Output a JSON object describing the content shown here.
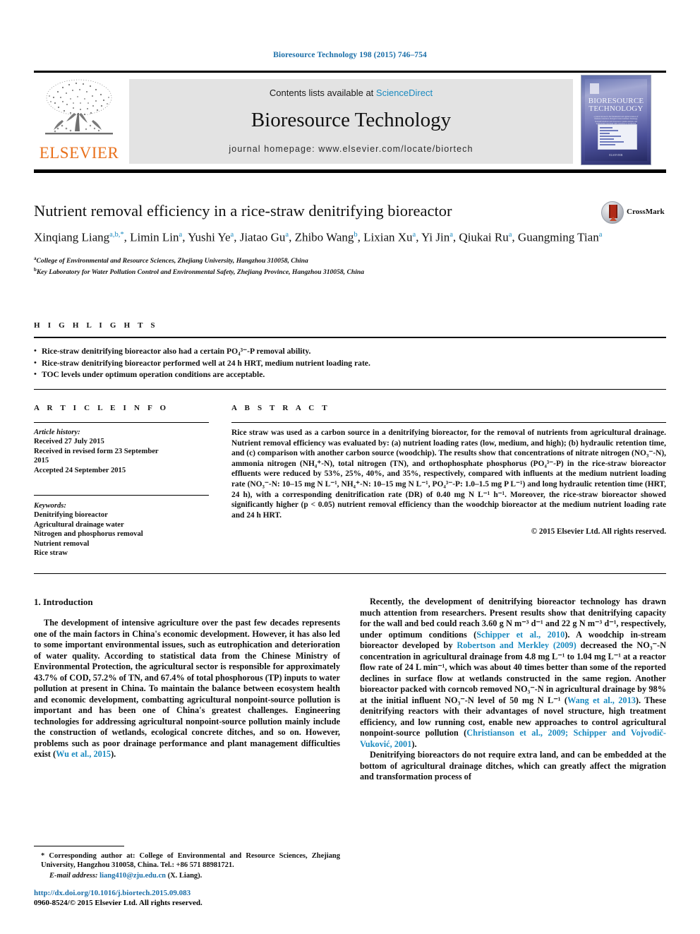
{
  "running_head": "Bioresource Technology 198 (2015) 746–754",
  "masthead": {
    "publisher_name": "ELSEVIER",
    "contents_prefix": "Contents lists available at ",
    "sciencedirect": "ScienceDirect",
    "journal_title": "Bioresource Technology",
    "homepage": "journal homepage: www.elsevier.com/locate/biortech",
    "cover_title_line1": "BIORESOURCE",
    "cover_title_line2": "TECHNOLOGY",
    "cover_blurb": "a journal devoted to the fundamental and applied sciences of biomass conversion, biological waste treatment, bioenergy, biotransformations and bioresource systems analysis, and technologies associated with conversion or production",
    "cover_bottom": "ELSEVIER",
    "sciencedirect_color": "#1a8ac0",
    "elsevier_orange": "#E9711C"
  },
  "title_block": {
    "title": "Nutrient removal efficiency in a rice-straw denitrifying bioreactor",
    "crossmark_label": "CrossMark",
    "authors": [
      {
        "name": "Xinqiang Liang",
        "sup": "a,b,*"
      },
      {
        "name": "Limin Lin",
        "sup": "a"
      },
      {
        "name": "Yushi Ye",
        "sup": "a"
      },
      {
        "name": "Jiatao Gu",
        "sup": "a"
      },
      {
        "name": "Zhibo Wang",
        "sup": "b"
      },
      {
        "name": "Lixian Xu",
        "sup": "a"
      },
      {
        "name": "Yi Jin",
        "sup": "a"
      },
      {
        "name": "Qiukai Ru",
        "sup": "a"
      },
      {
        "name": "Guangming Tian",
        "sup": "a"
      }
    ],
    "affiliations": [
      {
        "marker": "a",
        "text": "College of Environmental and Resource Sciences, Zhejiang University, Hangzhou 310058, China"
      },
      {
        "marker": "b",
        "text": "Key Laboratory for Water Pollution Control and Environmental Safety, Zhejiang Province, Hangzhou 310058, China"
      }
    ]
  },
  "highlights": {
    "label": "H I G H L I G H T S",
    "items": [
      "Rice-straw denitrifying bioreactor also had a certain PO₄³⁻-P removal ability.",
      "Rice-straw denitrifying bioreactor performed well at 24 h HRT, medium nutrient loading rate.",
      "TOC levels under optimum operation conditions are acceptable."
    ]
  },
  "article_info": {
    "label": "A R T I C L E   I N F O",
    "history_head": "Article history:",
    "history_lines": [
      "Received 27 July 2015",
      "Received in revised form 23 September",
      "2015",
      "Accepted 24 September 2015"
    ],
    "keywords_head": "Keywords:",
    "keywords": [
      "Denitrifying bioreactor",
      "Agricultural drainage water",
      "Nitrogen and phosphorus removal",
      "Nutrient removal",
      "Rice straw"
    ]
  },
  "abstract": {
    "label": "A B S T R A C T",
    "text": "Rice straw was used as a carbon source in a denitrifying bioreactor, for the removal of nutrients from agricultural drainage. Nutrient removal efficiency was evaluated by: (a) nutrient loading rates (low, medium, and high); (b) hydraulic retention time, and (c) comparison with another carbon source (woodchip). The results show that concentrations of nitrate nitrogen (NO₃⁻-N), ammonia nitrogen (NH₄⁺-N), total nitrogen (TN), and orthophosphate phosphorus (PO₄³⁻-P) in the rice-straw bioreactor effluents were reduced by 53%, 25%, 40%, and 35%, respectively, compared with influents at the medium nutrient loading rate (NO₃⁻-N: 10–15 mg N L⁻¹, NH₄⁺-N: 10–15 mg N L⁻¹, PO₄³⁻-P: 1.0–1.5 mg P L⁻¹) and long hydraulic retention time (HRT, 24 h), with a corresponding denitrification rate (DR) of 0.40 mg N L⁻¹ h⁻¹. Moreover, the rice-straw bioreactor showed significantly higher (p < 0.05) nutrient removal efficiency than the woodchip bioreactor at the medium nutrient loading rate and 24 h HRT.",
    "copyright": "© 2015 Elsevier Ltd. All rights reserved."
  },
  "body": {
    "section_title": "1. Introduction",
    "left_paragraph_1": "The development of intensive agriculture over the past few decades represents one of the main factors in China's economic development. However, it has also led to some important environmental issues, such as eutrophication and deterioration of water quality. According to statistical data from the Chinese Ministry of Environmental Protection, the agricultural sector is responsible for approximately 43.7% of COD, 57.2% of TN, and 67.4% of total phosphorous (TP) inputs to water pollution at present in China. To maintain the balance between ecosystem health and economic development, combatting agricultural nonpoint-source pollution is important and has been one of China's greatest challenges. Engineering technologies for addressing agricultural nonpoint-source pollution mainly include the construction of wetlands, ecological concrete ditches, and so on. However, problems such as poor drainage performance and plant management difficulties exist (",
    "left_cite_1": "Wu et al., 2015",
    "left_paragraph_1_end": ").",
    "right_p1_a": "Recently, the development of denitrifying bioreactor technology has drawn much attention from researchers. Present results show that denitrifying capacity for the wall and bed could reach 3.60 g N m⁻³ d⁻¹ and 22 g N m⁻³ d⁻¹, respectively, under optimum conditions (",
    "right_cite_1": "Schipper et al., 2010",
    "right_p1_b": "). A woodchip in-stream bioreactor developed by ",
    "right_cite_2": "Robertson and Merkley (2009)",
    "right_p1_c": " decreased the NO₃⁻-N concentration in agricultural drainage from 4.8 mg L⁻¹ to 1.04 mg L⁻¹ at a reactor flow rate of 24 L min⁻¹, which was about 40 times better than some of the reported declines in surface flow at wetlands constructed in the same region. Another bioreactor packed with corncob removed NO₃⁻-N in agricultural drainage by 98% at the initial influent NO₃⁻-N level of 50 mg N L⁻¹ (",
    "right_cite_3": "Wang et al., 2013",
    "right_p1_d": "). These denitrifying reactors with their advantages of novel structure, high treatment efficiency, and low running cost, enable new approaches to control agricultural nonpoint-source pollution (",
    "right_cite_4": "Christianson et al., 2009; Schipper and Vojvodič-Vuković, 2001",
    "right_p1_e": ").",
    "right_p2": "Denitrifying bioreactors do not require extra land, and can be embedded at the bottom of agricultural drainage ditches, which can greatly affect the migration and transformation process of"
  },
  "footnote": {
    "corresponding": "* Corresponding author at: College of Environmental and Resource Sciences, Zhejiang University, Hangzhou 310058, China. Tel.: +86 571 88981721.",
    "email_label": "E-mail address:",
    "email": "liang410@zju.edu.cn",
    "email_suffix": "(X. Liang)."
  },
  "doi_block": {
    "doi_url": "http://dx.doi.org/10.1016/j.biortech.2015.09.083",
    "issn_line": "0960-8524/© 2015 Elsevier Ltd. All rights reserved."
  }
}
